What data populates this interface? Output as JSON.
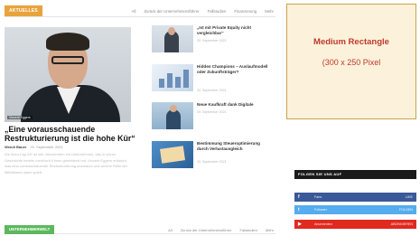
{
  "top_section": {
    "tag": "AKTUELLES",
    "tabs": [
      "All",
      "Zurück der Unternehmensführer",
      "Fallstudien",
      "Finanzierung",
      "Mehr"
    ]
  },
  "hero": {
    "photo_caption": "Vincent Eggers",
    "title": "„Eine vorausschauende Restrukturierung ist die hohe Kür“",
    "author": "Wendi Bauer",
    "date": "20. September 2021",
    "excerpt": "Die Bord-Cap AG ist seit Jahrzehnten ein Unternehmen, das in seiner Geschichte bereits mehrfach Krisen gemeistert hat. Vincent Eggers erläutert, was eine vorausschauende Restrukturierung ausmacht und welche Rolle der Mittelstand dabei spielt."
  },
  "articles": [
    {
      "title": "„Ist mit Private Equity nicht vergleichbar“",
      "date": "20. September 2021"
    },
    {
      "title": "Hidden Champions – Auslaufmodell oder Zukunftsträger?",
      "date": "20. September 2021"
    },
    {
      "title": "Neue Kaufkraft dank Digitale",
      "date": "20. September 2021"
    },
    {
      "title": "Bestimmung Steueroptimierung durch Verlustausgleich",
      "date": "20. September 2021"
    }
  ],
  "ad": {
    "title": "Medium Rectangle",
    "size": "(300 x 250 Pixel"
  },
  "social": {
    "heading": "FOLGEN SIE UNS AUF",
    "rows": [
      {
        "icon": "f",
        "label": "Fans",
        "count": "LIKE"
      },
      {
        "icon": "t",
        "label": "Follower",
        "count": "FOLGEN"
      },
      {
        "icon": "▶",
        "label": "Abonnenten",
        "count": "ABONNIEREN"
      }
    ]
  },
  "bottom_section": {
    "tag": "UNTERNEHMERWELT",
    "tabs": [
      "All",
      "Zurück der Unternehmensführer",
      "Fallstudien",
      "Mehr"
    ]
  },
  "colors": {
    "accent_orange": "#e8a33c",
    "accent_green": "#5cb85c",
    "ad_red": "#c0392b",
    "ad_bg": "#fcf2dc",
    "facebook": "#3b5998",
    "twitter": "#55acee",
    "youtube": "#e02a20"
  }
}
